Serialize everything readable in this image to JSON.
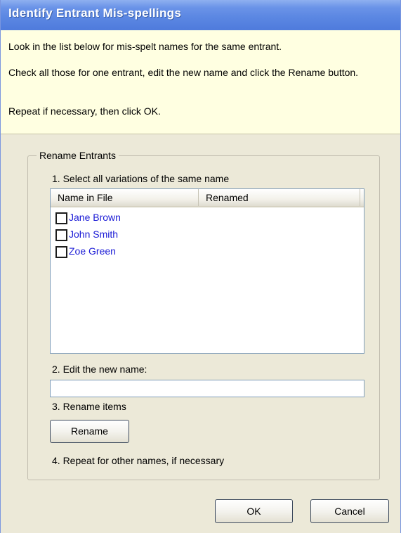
{
  "window": {
    "title": "Identify Entrant Mis-spellings"
  },
  "intro": {
    "line1": "Look in the list below for mis-spelt names for the same entrant.",
    "line2": "Check all those for one entrant, edit the new name and click the Rename button.",
    "line3": "Repeat if necessary, then click OK."
  },
  "group": {
    "legend": "Rename Entrants",
    "step1": "1. Select all variations of the same name",
    "step2": "2. Edit the new name:",
    "step3": "3. Rename items",
    "step4": "4. Repeat for other names, if necessary"
  },
  "list": {
    "columns": [
      "Name in File",
      "Renamed"
    ],
    "rows": [
      {
        "name": "Jane Brown",
        "renamed": "",
        "checked": false
      },
      {
        "name": "John Smith",
        "renamed": "",
        "checked": false
      },
      {
        "name": "Zoe Green",
        "renamed": "",
        "checked": false
      }
    ]
  },
  "new_name": {
    "value": "",
    "placeholder": ""
  },
  "buttons": {
    "rename": "Rename",
    "ok": "OK",
    "cancel": "Cancel"
  },
  "colors": {
    "title_bar": "#5a86e2",
    "info_panel": "#ffffe1",
    "dialog_bg": "#ece9d8",
    "list_item_text": "#1a1ad6"
  }
}
